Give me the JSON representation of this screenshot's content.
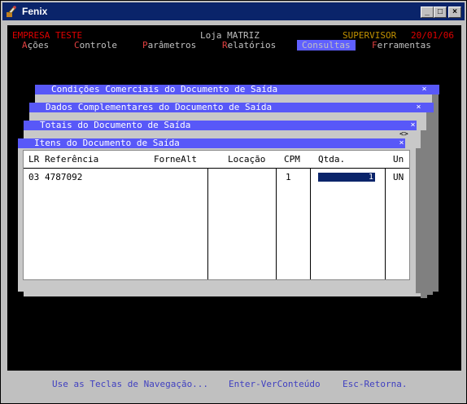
{
  "window": {
    "title": "Fenix",
    "min_label": "_",
    "max_label": "□",
    "close_label": "×"
  },
  "header": {
    "company": "EMPRESA TESTE",
    "store": "Loja MATRIZ",
    "user": "SUPERVISOR",
    "date": "20/01/06"
  },
  "menu": {
    "items": [
      {
        "hotkey": "A",
        "rest": "ções"
      },
      {
        "hotkey": "C",
        "rest": "ontrole"
      },
      {
        "hotkey": "P",
        "rest": "arâmetros"
      },
      {
        "hotkey": "R",
        "rest": "elatórios"
      },
      {
        "label": "Consultas",
        "selected": true
      },
      {
        "hotkey": "F",
        "rest": "erramentas"
      }
    ]
  },
  "subwindows": [
    {
      "title": "Condições Comerciais do Documento de Saída",
      "close": "×"
    },
    {
      "title": "Dados Complementares do Documento de Saída",
      "close": "×"
    },
    {
      "title": "Totais do Documento de Saída",
      "close": "×",
      "extra": "<>"
    },
    {
      "title": "Itens do Documento de Saída",
      "close": "×"
    }
  ],
  "grid": {
    "columns": [
      "LR",
      "Referência",
      "ForneAlt",
      "Locação",
      "CPM",
      "Qtda.",
      "Un"
    ],
    "rows": [
      {
        "lr": "03",
        "ref": "4787092",
        "forne": "",
        "loc": "",
        "cpm": "1",
        "qtda": "1",
        "un": "UN"
      }
    ]
  },
  "status": {
    "nav": "Use as Teclas de Navegação...",
    "enter": "Enter-VerConteúdo",
    "esc": "Esc-Retorna."
  },
  "colors": {
    "title_bar": "#0a246a",
    "subwindow_bar": "#5858f8",
    "menu_hotkey": "#e04040",
    "header_red": "#e00000",
    "header_user": "#c09000",
    "status_text": "#4040c0"
  }
}
